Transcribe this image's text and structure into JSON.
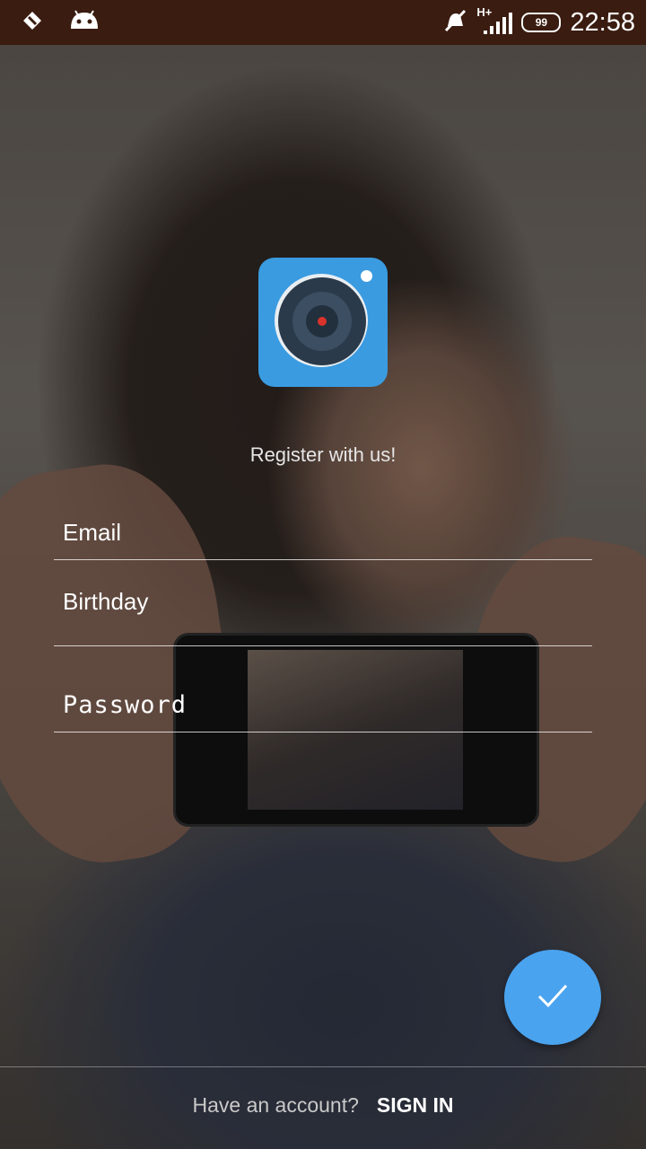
{
  "status_bar": {
    "time": "22:58",
    "network": "H+",
    "battery": "99",
    "icons": [
      "flashlight-icon",
      "android-icon",
      "mute-icon",
      "signal-icon",
      "battery-icon"
    ]
  },
  "register": {
    "tagline": "Register with us!",
    "email_placeholder": "Email",
    "birthday_placeholder": "Birthday",
    "password_placeholder": "Password"
  },
  "submit": {
    "icon": "checkmark-icon",
    "color": "#4aa3ef"
  },
  "footer": {
    "question": "Have an account?",
    "sign_in_label": "SIGN IN"
  },
  "colors": {
    "status_bar": "#3a1c10",
    "logo_bg": "#3a9be0"
  }
}
